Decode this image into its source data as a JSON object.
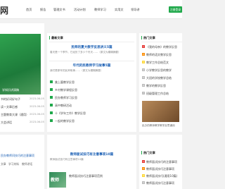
{
  "header": {
    "logo": "网",
    "nav": [
      "首页",
      "报告",
      "管理文书",
      "活动计划",
      "教师学习",
      "实用文",
      "领导讲"
    ],
    "register": "注册登录"
  },
  "left": {
    "caption": "学知识讲演稿",
    "items": [
      {
        "title": "书的好词好句子",
        "date": "2023-06-05"
      },
      {
        "title": "读一文章后感",
        "date": "2023-06-05"
      },
      {
        "title": "主题教育大课（通用）",
        "date": "2023-06-05"
      },
      {
        "title": "大会讲话",
        "date": "2023-06-05"
      },
      {
        "title": "教学反思",
        "date": "2023-06-05"
      }
    ],
    "bottom_items": [
      {
        "title": "话活动感想(通用5篇)"
      },
      {
        "title": "教师学习感(通用5篇)"
      },
      {
        "title": "教育、教育教研"
      }
    ],
    "bottom_title": "书活动感想(通用5篇)"
  },
  "center": {
    "heading": "最新文章",
    "article1": {
      "title": "民师的夏大教学反思讲义5篇",
      "summary": "春天是一个季节，它经历了多少个冬天……（原文为模糊摘要）"
    },
    "article2": {
      "title": "年代的民教师学习故事5篇",
      "summary": "我们是那年的民师故事……（原文为模糊摘要）"
    },
    "list": [
      "美上篇教学反思",
      "乡村教学课程反思",
      "民办教师学习反思",
      "高中教研活动",
      "十《学年工作》教学反思",
      "一起的教学反思"
    ]
  },
  "right": {
    "heading": "热门文章",
    "items": [
      "《我的母亲》的教学反思",
      "教师的语文教学反思",
      "教学工作总结范文",
      "小学教学反思的教学",
      "大班的学校教学总结",
      "教学的教学反思",
      "班级管理工作总结",
      "《外面与太阳》教学反思"
    ],
    "caption": "民办的教师教学教学反思通用"
  },
  "lower": {
    "title": "教师面试技巧有注意事项10篇",
    "left_title": "民办教师问技巧的注意事项",
    "tabs": [
      "文章",
      "学习材料",
      "教师讲话",
      "教师",
      "信息"
    ],
    "right_heading": "热门文章",
    "right_items": [
      "教师面试技巧的注意事项",
      "教师面试技巧注意事项",
      "教师面试技巧(通用10篇)",
      "教师面试技巧注意事项"
    ],
    "article_item": "教师面试技巧注意事项范例",
    "thumb_label": "教师"
  }
}
